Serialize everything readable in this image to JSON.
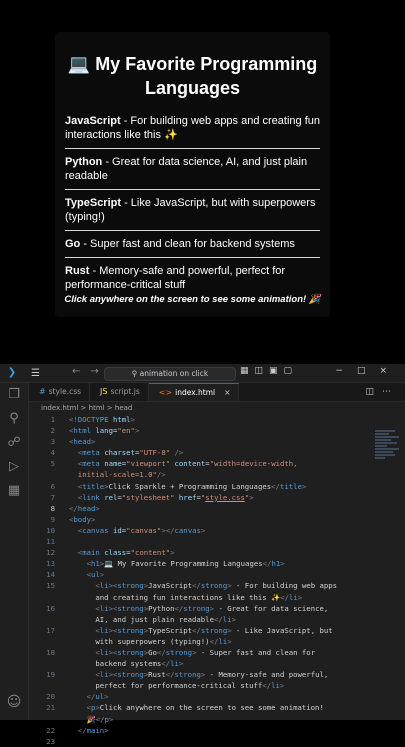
{
  "preview": {
    "title_icon": "💻",
    "title": "My Favorite Programming Languages",
    "languages": [
      {
        "name": "JavaScript",
        "desc": " - For building web apps and creating fun interactions like this ✨"
      },
      {
        "name": "Python",
        "desc": " - Great for data science, AI, and just plain readable"
      },
      {
        "name": "TypeScript",
        "desc": " - Like JavaScript, but with superpowers (typing!)"
      },
      {
        "name": "Go",
        "desc": " - Super fast and clean for backend systems"
      },
      {
        "name": "Rust",
        "desc": " - Memory-safe and powerful, perfect for performance-critical stuff"
      }
    ],
    "footer": "Click anywhere on the screen to see some animation! 🎉"
  },
  "vscode": {
    "search_placeholder": "animation on click",
    "tabs": [
      {
        "label": "style.css",
        "icon": "#"
      },
      {
        "label": "script.js",
        "icon": "JS"
      },
      {
        "label": "index.html",
        "icon": "<>",
        "active": true
      }
    ],
    "breadcrumb": "index.html > html > head",
    "code_lines": [
      {
        "n": "1",
        "html": "<span class='p'>&lt;!</span><span class='t'>DOCTYPE</span> <span class='a'>html</span><span class='p'>&gt;</span>"
      },
      {
        "n": "2",
        "html": "<span class='p'>&lt;</span><span class='t'>html</span> <span class='a'>lang</span><span class='w'>=</span><span class='s'>\"en\"</span><span class='p'>&gt;</span>"
      },
      {
        "n": "3",
        "html": "<span class='p'>&lt;</span><span class='t'>head</span><span class='p'>&gt;</span>"
      },
      {
        "n": "4",
        "html": "  <span class='p'>&lt;</span><span class='t'>meta</span> <span class='a'>charset</span><span class='w'>=</span><span class='s'>\"UTF-8\"</span> <span class='p'>/&gt;</span>"
      },
      {
        "n": "5",
        "html": "  <span class='p'>&lt;</span><span class='t'>meta</span> <span class='a'>name</span><span class='w'>=</span><span class='s'>\"viewport\"</span> <span class='a'>content</span><span class='w'>=</span><span class='s'>\"width=device-width,</span>"
      },
      {
        "n": "",
        "html": "  <span class='s'>initial-scale=1.0\"</span><span class='p'>/&gt;</span>"
      },
      {
        "n": "6",
        "html": "  <span class='p'>&lt;</span><span class='t'>title</span><span class='p'>&gt;</span>Click Sparkle + Programming Languages<span class='p'>&lt;/</span><span class='t'>title</span><span class='p'>&gt;</span>"
      },
      {
        "n": "7",
        "html": "  <span class='p'>&lt;</span><span class='t'>link</span> <span class='a'>rel</span><span class='w'>=</span><span class='s'>\"stylesheet\"</span> <span class='a'>href</span><span class='w'>=</span><span class='s'>\"<u>style.css</u>\"</span><span class='p'>&gt;</span>"
      },
      {
        "n": "8",
        "html": "<span class='p'>&lt;/</span><span class='t'>head</span><span class='p'>&gt;</span>",
        "cur": true
      },
      {
        "n": "9",
        "html": "<span class='p'>&lt;</span><span class='t'>body</span><span class='p'>&gt;</span>"
      },
      {
        "n": "10",
        "html": "  <span class='p'>&lt;</span><span class='t'>canvas</span> <span class='a'>id</span><span class='w'>=</span><span class='s'>\"canvas\"</span><span class='p'>&gt;&lt;/</span><span class='t'>canvas</span><span class='p'>&gt;</span>"
      },
      {
        "n": "11",
        "html": ""
      },
      {
        "n": "12",
        "html": "  <span class='p'>&lt;</span><span class='t'>main</span> <span class='a'>class</span><span class='w'>=</span><span class='s'>\"content\"</span><span class='p'>&gt;</span>"
      },
      {
        "n": "13",
        "html": "    <span class='p'>&lt;</span><span class='t'>h1</span><span class='p'>&gt;</span>💻 My Favorite Programming Languages<span class='p'>&lt;/</span><span class='t'>h1</span><span class='p'>&gt;</span>"
      },
      {
        "n": "14",
        "html": "    <span class='p'>&lt;</span><span class='t'>ul</span><span class='p'>&gt;</span>"
      },
      {
        "n": "15",
        "html": "      <span class='p'>&lt;</span><span class='t'>li</span><span class='p'>&gt;&lt;</span><span class='t'>strong</span><span class='p'>&gt;</span>JavaScript<span class='p'>&lt;/</span><span class='t'>strong</span><span class='p'>&gt;</span> - For building web apps"
      },
      {
        "n": "",
        "html": "      and creating fun interactions like this ✨<span class='p'>&lt;/</span><span class='t'>li</span><span class='p'>&gt;</span>"
      },
      {
        "n": "16",
        "html": "      <span class='p'>&lt;</span><span class='t'>li</span><span class='p'>&gt;&lt;</span><span class='t'>strong</span><span class='p'>&gt;</span>Python<span class='p'>&lt;/</span><span class='t'>strong</span><span class='p'>&gt;</span> - Great for data science,"
      },
      {
        "n": "",
        "html": "      AI, and just plain readable<span class='p'>&lt;/</span><span class='t'>li</span><span class='p'>&gt;</span>"
      },
      {
        "n": "17",
        "html": "      <span class='p'>&lt;</span><span class='t'>li</span><span class='p'>&gt;&lt;</span><span class='t'>strong</span><span class='p'>&gt;</span>TypeScript<span class='p'>&lt;/</span><span class='t'>strong</span><span class='p'>&gt;</span> - Like JavaScript, but"
      },
      {
        "n": "",
        "html": "      with superpowers (typing!)<span class='p'>&lt;/</span><span class='t'>li</span><span class='p'>&gt;</span>"
      },
      {
        "n": "18",
        "html": "      <span class='p'>&lt;</span><span class='t'>li</span><span class='p'>&gt;&lt;</span><span class='t'>strong</span><span class='p'>&gt;</span>Go<span class='p'>&lt;/</span><span class='t'>strong</span><span class='p'>&gt;</span> - Super fast and clean for"
      },
      {
        "n": "",
        "html": "      backend systems<span class='p'>&lt;/</span><span class='t'>li</span><span class='p'>&gt;</span>"
      },
      {
        "n": "19",
        "html": "      <span class='p'>&lt;</span><span class='t'>li</span><span class='p'>&gt;&lt;</span><span class='t'>strong</span><span class='p'>&gt;</span>Rust<span class='p'>&lt;/</span><span class='t'>strong</span><span class='p'>&gt;</span> - Memory-safe and powerful,"
      },
      {
        "n": "",
        "html": "      perfect for performance-critical stuff<span class='p'>&lt;/</span><span class='t'>li</span><span class='p'>&gt;</span>"
      },
      {
        "n": "20",
        "html": "    <span class='p'>&lt;/</span><span class='t'>ul</span><span class='p'>&gt;</span>"
      },
      {
        "n": "21",
        "html": "    <span class='p'>&lt;</span><span class='t'>p</span><span class='p'>&gt;</span>Click anywhere on the screen to see some animation!"
      },
      {
        "n": "",
        "html": "    🎉<span class='p'>&lt;/</span><span class='t'>p</span><span class='p'>&gt;</span>"
      },
      {
        "n": "22",
        "html": "  <span class='p'>&lt;/</span><span class='t'>main</span><span class='p'>&gt;</span>"
      },
      {
        "n": "23",
        "html": ""
      }
    ]
  }
}
